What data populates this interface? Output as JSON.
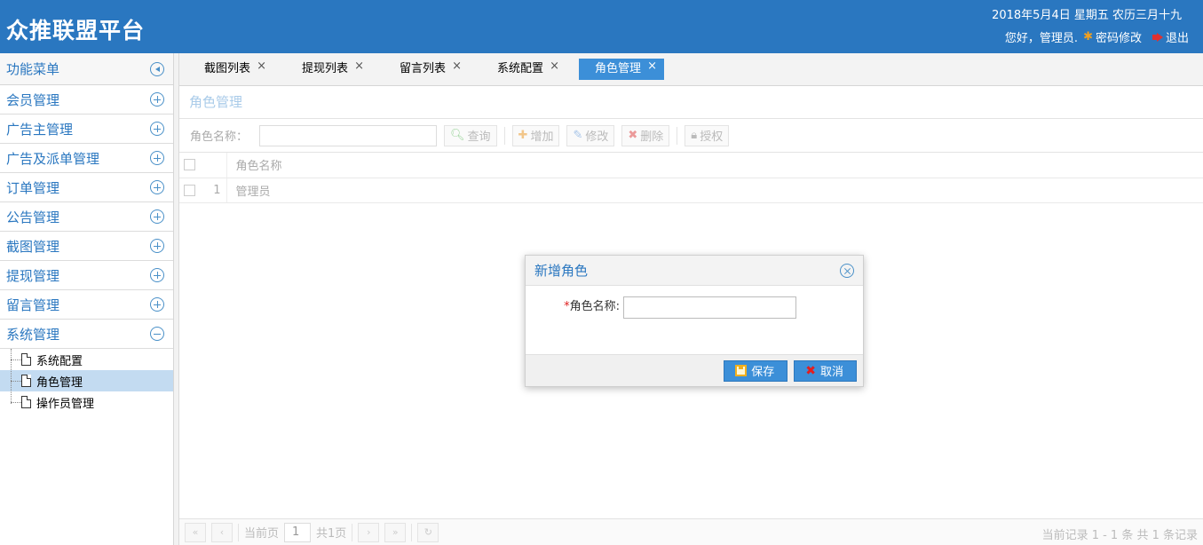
{
  "header": {
    "brand": "众推联盟平台",
    "date": "2018年5月4日 星期五 农历三月十九",
    "greeting": "您好，管理员.",
    "change_password": "密码修改",
    "logout": "退出"
  },
  "sidebar": {
    "title": "功能菜单",
    "items": [
      {
        "label": "会员管理"
      },
      {
        "label": "广告主管理"
      },
      {
        "label": "广告及派单管理"
      },
      {
        "label": "订单管理"
      },
      {
        "label": "公告管理"
      },
      {
        "label": "截图管理"
      },
      {
        "label": "提现管理"
      },
      {
        "label": "留言管理"
      },
      {
        "label": "系统管理"
      }
    ],
    "sub_items": [
      {
        "label": "系统配置"
      },
      {
        "label": "角色管理"
      },
      {
        "label": "操作员管理"
      }
    ]
  },
  "tabs": [
    {
      "label": "截图列表"
    },
    {
      "label": "提现列表"
    },
    {
      "label": "留言列表"
    },
    {
      "label": "系统配置"
    },
    {
      "label": "角色管理"
    }
  ],
  "panel": {
    "title": "角色管理",
    "search_label": "角色名称：",
    "buttons": {
      "query": "查询",
      "add": "增加",
      "edit": "修改",
      "delete": "删除",
      "authorize": "授权"
    },
    "table": {
      "header": "角色名称",
      "rows": [
        {
          "num": "1",
          "name": "管理员"
        }
      ]
    },
    "pager": {
      "current_page_label": "当前页",
      "current_page": "1",
      "total_pages": "共1页",
      "info": "当前记录 1 - 1 条 共 1 条记录"
    }
  },
  "dialog": {
    "title": "新增角色",
    "required_mark": "*",
    "field_label": "角色名称:",
    "field_value": "",
    "save": "保存",
    "cancel": "取消"
  },
  "colors": {
    "brand_blue": "#2a77c0",
    "active_tab": "#3c8fd8",
    "selected_row": "#c3dbf1"
  }
}
